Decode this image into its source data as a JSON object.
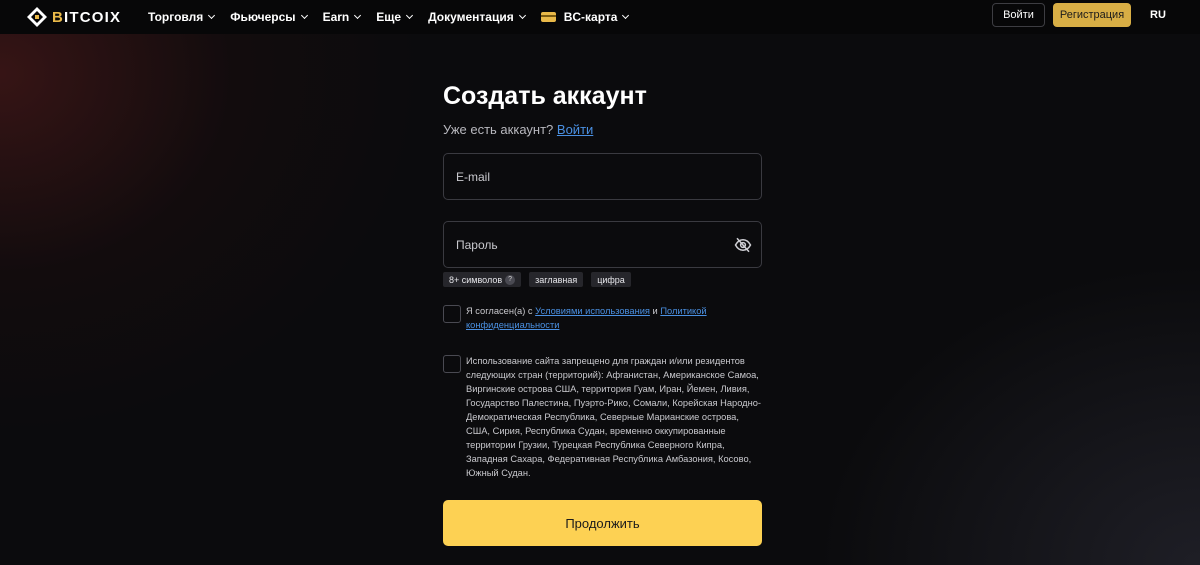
{
  "colors": {
    "accent": "#e9b949",
    "primary_button": "#fdd153",
    "link": "#4a90e2",
    "background": "#0b0b0d"
  },
  "header": {
    "logo": {
      "prefix": "B",
      "text": "ITCOIX",
      "icon": "bitcoix-logo-icon"
    },
    "nav": [
      {
        "label": "Торговля"
      },
      {
        "label": "Фьючерсы"
      },
      {
        "label": "Earn"
      },
      {
        "label": "Еще"
      },
      {
        "label": "Документация"
      },
      {
        "label": "BC-карта",
        "icon": "card-icon"
      }
    ],
    "login_label": "Войти",
    "register_label": "Регистрация",
    "language": "RU"
  },
  "form": {
    "title": "Создать аккаунт",
    "have_account": "Уже есть аккаунт?",
    "login_link": "Войти",
    "email_placeholder": "E-mail",
    "password_placeholder": "Пароль",
    "password_icon": "eye-off-icon",
    "hints": {
      "length": "8+ символов",
      "help": "?",
      "uppercase": "заглавная",
      "digit": "цифра"
    },
    "terms": {
      "prefix": "Я согласен(а) с",
      "terms_link": "Условиями использования",
      "and": "и",
      "privacy_link": "Политикой конфиденциальности"
    },
    "restriction_text": "Использование сайта запрещено для граждан и/или резидентов следующих стран (территорий): Афганистан, Американское Самоа, Виргинские острова США, территория Гуам, Иран, Йемен, Ливия, Государство Палестина, Пуэрто-Рико, Сомали, Корейская Народно-Демократическая Республика, Северные Марианские острова, США, Сирия, Республика Судан, временно оккупированные территории Грузии, Турецкая Республика Северного Кипра, Западная Сахара, Федеративная Республика Амбазония, Косово, Южный Судан.",
    "continue_label": "Продолжить"
  }
}
